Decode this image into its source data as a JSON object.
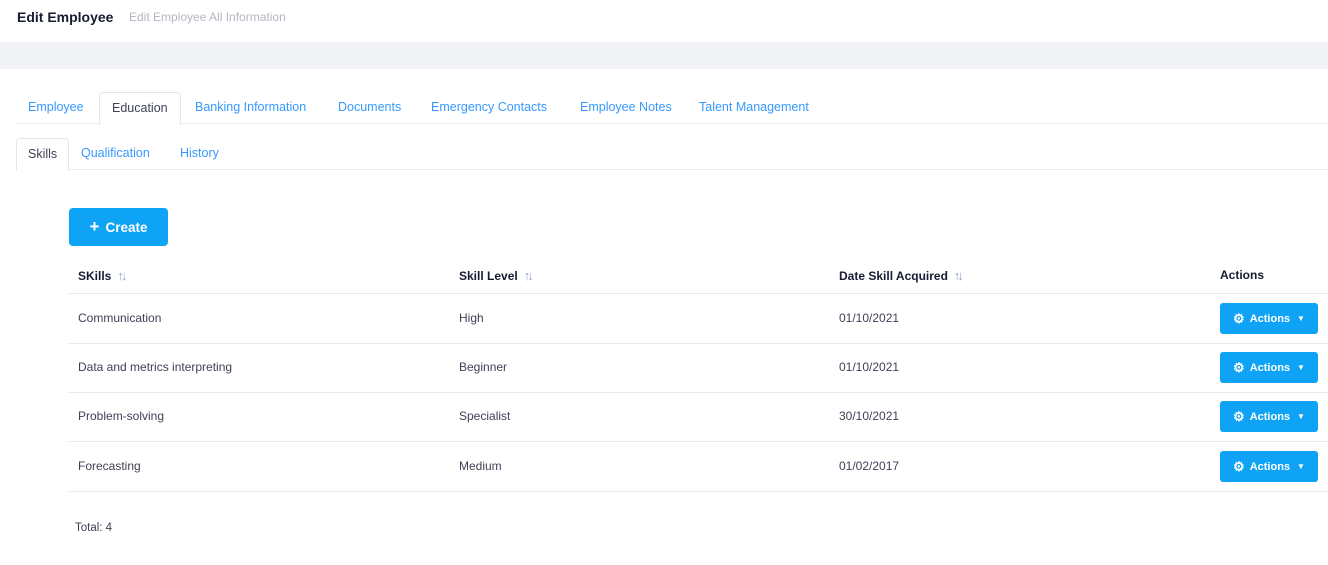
{
  "header": {
    "title": "Edit Employee",
    "description": "Edit Employee All Information"
  },
  "tabs": [
    {
      "label": "Employee",
      "active": false
    },
    {
      "label": "Education",
      "active": true
    },
    {
      "label": "Banking Information",
      "active": false
    },
    {
      "label": "Documents",
      "active": false
    },
    {
      "label": "Emergency Contacts",
      "active": false
    },
    {
      "label": "Employee Notes",
      "active": false
    },
    {
      "label": "Talent Management",
      "active": false
    }
  ],
  "subtabs": [
    {
      "label": "Skills",
      "active": true
    },
    {
      "label": "Qualification",
      "active": false
    },
    {
      "label": "History",
      "active": false
    }
  ],
  "create_button": {
    "label": "Create",
    "icon": "plus-icon"
  },
  "table": {
    "columns": [
      "SKills",
      "Skill Level",
      "Date Skill Acquired",
      "Actions"
    ],
    "rows": [
      {
        "skill": "Communication",
        "level": "High",
        "date": "01/10/2021",
        "action": "Actions"
      },
      {
        "skill": "Data and metrics interpreting",
        "level": "Beginner",
        "date": "01/10/2021",
        "action": "Actions"
      },
      {
        "skill": "Problem-solving",
        "level": "Specialist",
        "date": "30/10/2021",
        "action": "Actions"
      },
      {
        "skill": "Forecasting",
        "level": "Medium",
        "date": "01/02/2017",
        "action": "Actions"
      }
    ]
  },
  "total": "Total: 4",
  "colors": {
    "primary": "#0fa3f5",
    "link": "#3699ff",
    "band": "#f2f3f7"
  }
}
